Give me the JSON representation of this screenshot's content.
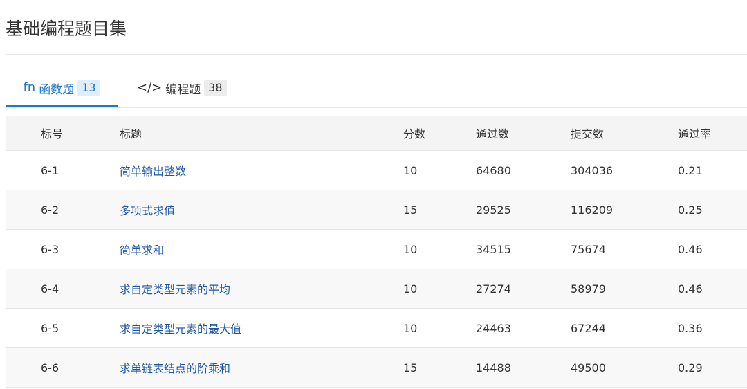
{
  "page": {
    "title": "基础编程题目集"
  },
  "tabs": [
    {
      "icon": "function-icon",
      "icon_glyph": "fn",
      "label": "函数题",
      "count": "13",
      "active": true
    },
    {
      "icon": "code-icon",
      "icon_glyph": "</>",
      "label": "编程题",
      "count": "38",
      "active": false
    }
  ],
  "colors": {
    "accent": "#1f78d1",
    "link": "#1b56a6",
    "header_bg": "#f4f4f5"
  },
  "table": {
    "headers": {
      "id": "标号",
      "title": "标题",
      "score": "分数",
      "passed": "通过数",
      "submitted": "提交数",
      "rate": "通过率"
    },
    "rows": [
      {
        "id": "6-1",
        "title": "简单输出整数",
        "score": "10",
        "passed": "64680",
        "submitted": "304036",
        "rate": "0.21"
      },
      {
        "id": "6-2",
        "title": "多项式求值",
        "score": "15",
        "passed": "29525",
        "submitted": "116209",
        "rate": "0.25"
      },
      {
        "id": "6-3",
        "title": "简单求和",
        "score": "10",
        "passed": "34515",
        "submitted": "75674",
        "rate": "0.46"
      },
      {
        "id": "6-4",
        "title": "求自定类型元素的平均",
        "score": "10",
        "passed": "27274",
        "submitted": "58979",
        "rate": "0.46"
      },
      {
        "id": "6-5",
        "title": "求自定类型元素的最大值",
        "score": "10",
        "passed": "24463",
        "submitted": "67244",
        "rate": "0.36"
      },
      {
        "id": "6-6",
        "title": "求单链表结点的阶乘和",
        "score": "15",
        "passed": "14488",
        "submitted": "49500",
        "rate": "0.29"
      }
    ]
  }
}
